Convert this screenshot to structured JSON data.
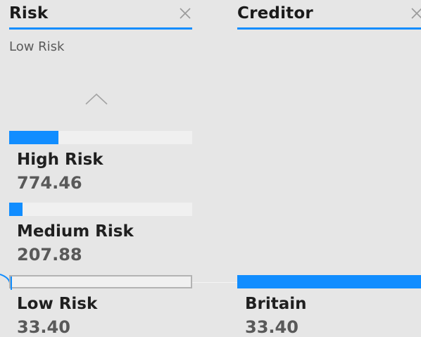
{
  "risk_slicer": {
    "title": "Risk",
    "selection_text": "Low Risk",
    "items": [
      {
        "label": "High Risk",
        "value": "774.46",
        "fill_fraction": 0.27
      },
      {
        "label": "Medium Risk",
        "value": "207.88",
        "fill_fraction": 0.07
      },
      {
        "label": "Low Risk",
        "value": "33.40",
        "fill_fraction": 0.01
      }
    ]
  },
  "creditor_slicer": {
    "title": "Creditor",
    "items": [
      {
        "label": "Britain",
        "value": "33.40",
        "fill_fraction": 1.0
      }
    ]
  },
  "colors": {
    "accent": "#118dff",
    "background": "#e6e6e6"
  },
  "icons": {
    "close": "close-x-icon",
    "chevron": "chevron-up-icon"
  }
}
